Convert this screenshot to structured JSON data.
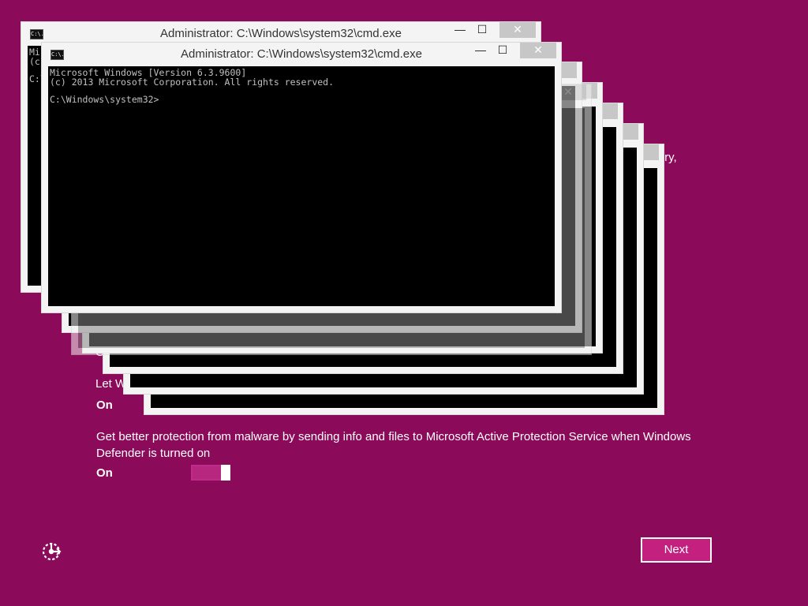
{
  "oobe": {
    "peek_texts": [
      ",ry,",
      "C",
      "Let W"
    ],
    "on_label_1": "On",
    "protection_description": "Get better protection from malware by sending info and files to Microsoft Active Protection Service when Windows Defender is turned on",
    "on_label_2": "On",
    "protection_toggle_state": "on",
    "next_label": "Next",
    "accent_color": "#8c0a5a"
  },
  "cmd": {
    "title": "Administrator: C:\\Windows\\system32\\cmd.exe",
    "app_icon_text": "C:\\.",
    "caption": {
      "minimize": "—",
      "maximize": "☐",
      "close": "✕"
    },
    "console_lines": [
      "Microsoft Windows [Version 6.3.9600]",
      "(c) 2013 Microsoft Corporation. All rights reserved."
    ],
    "prompt": "C:\\Windows\\system32>"
  }
}
